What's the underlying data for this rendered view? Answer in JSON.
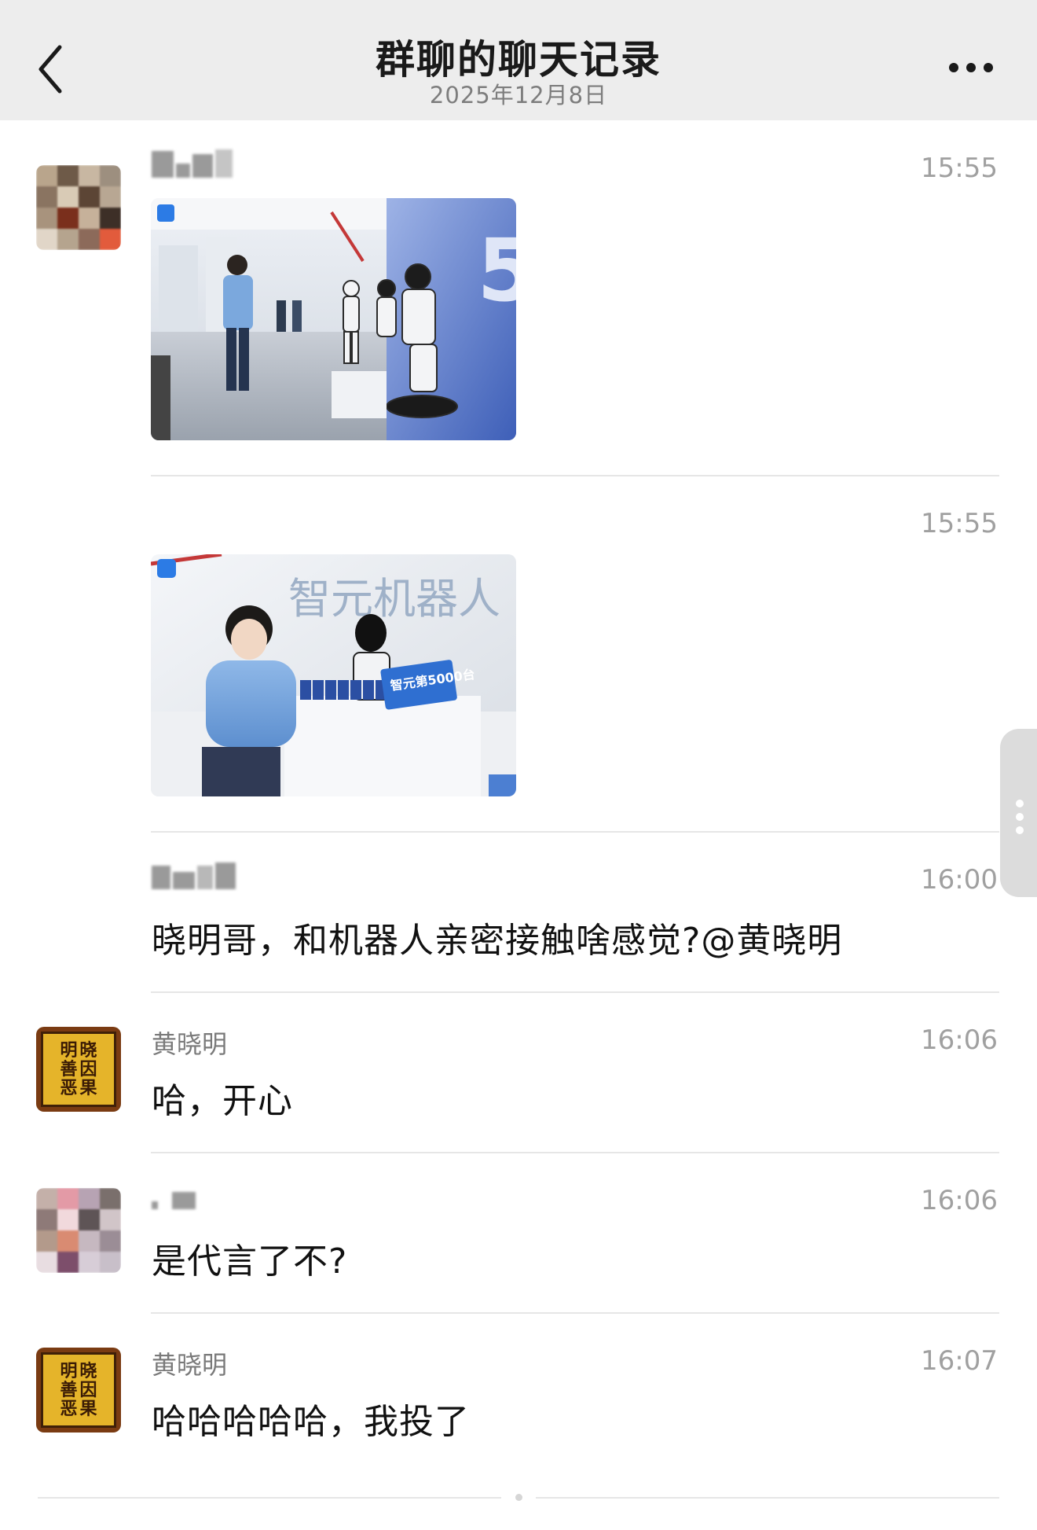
{
  "header": {
    "title": "群聊的聊天记录",
    "date": "2025年12月8日",
    "back_icon": "chevron-left-icon",
    "more_icon": "more-horizontal-icon"
  },
  "messages": [
    {
      "sender": "",
      "sender_blurred": true,
      "time": "15:55",
      "type": "image",
      "image_description": "robot exhibition hall photo"
    },
    {
      "sender": "",
      "sender_blurred": false,
      "time": "15:55",
      "type": "image",
      "image_description": "man with robot at counter"
    },
    {
      "sender": "",
      "sender_blurred": true,
      "time": "16:00",
      "type": "text",
      "text": "晓明哥，和机器人亲密接触啥感觉?@黄晓明"
    },
    {
      "sender": "黄晓明",
      "time": "16:06",
      "type": "text",
      "text": "哈，开心"
    },
    {
      "sender": "",
      "sender_blurred": true,
      "time": "16:06",
      "type": "text",
      "text": "是代言了不?"
    },
    {
      "sender": "黄晓明",
      "time": "16:07",
      "type": "text",
      "text": "哈哈哈哈哈，我投了"
    }
  ],
  "seal_avatar": {
    "characters_right": "晓因果",
    "characters_left": "明善恶"
  },
  "photo2_signage": {
    "brand_text": "智元机器人",
    "banner_text": "智元第5000台"
  },
  "colors": {
    "header_bg": "#ededed",
    "time_text": "#a0a0a0",
    "name_text": "#7a7a7a",
    "message_text": "#111111",
    "seal_yellow": "#e5b42a"
  }
}
